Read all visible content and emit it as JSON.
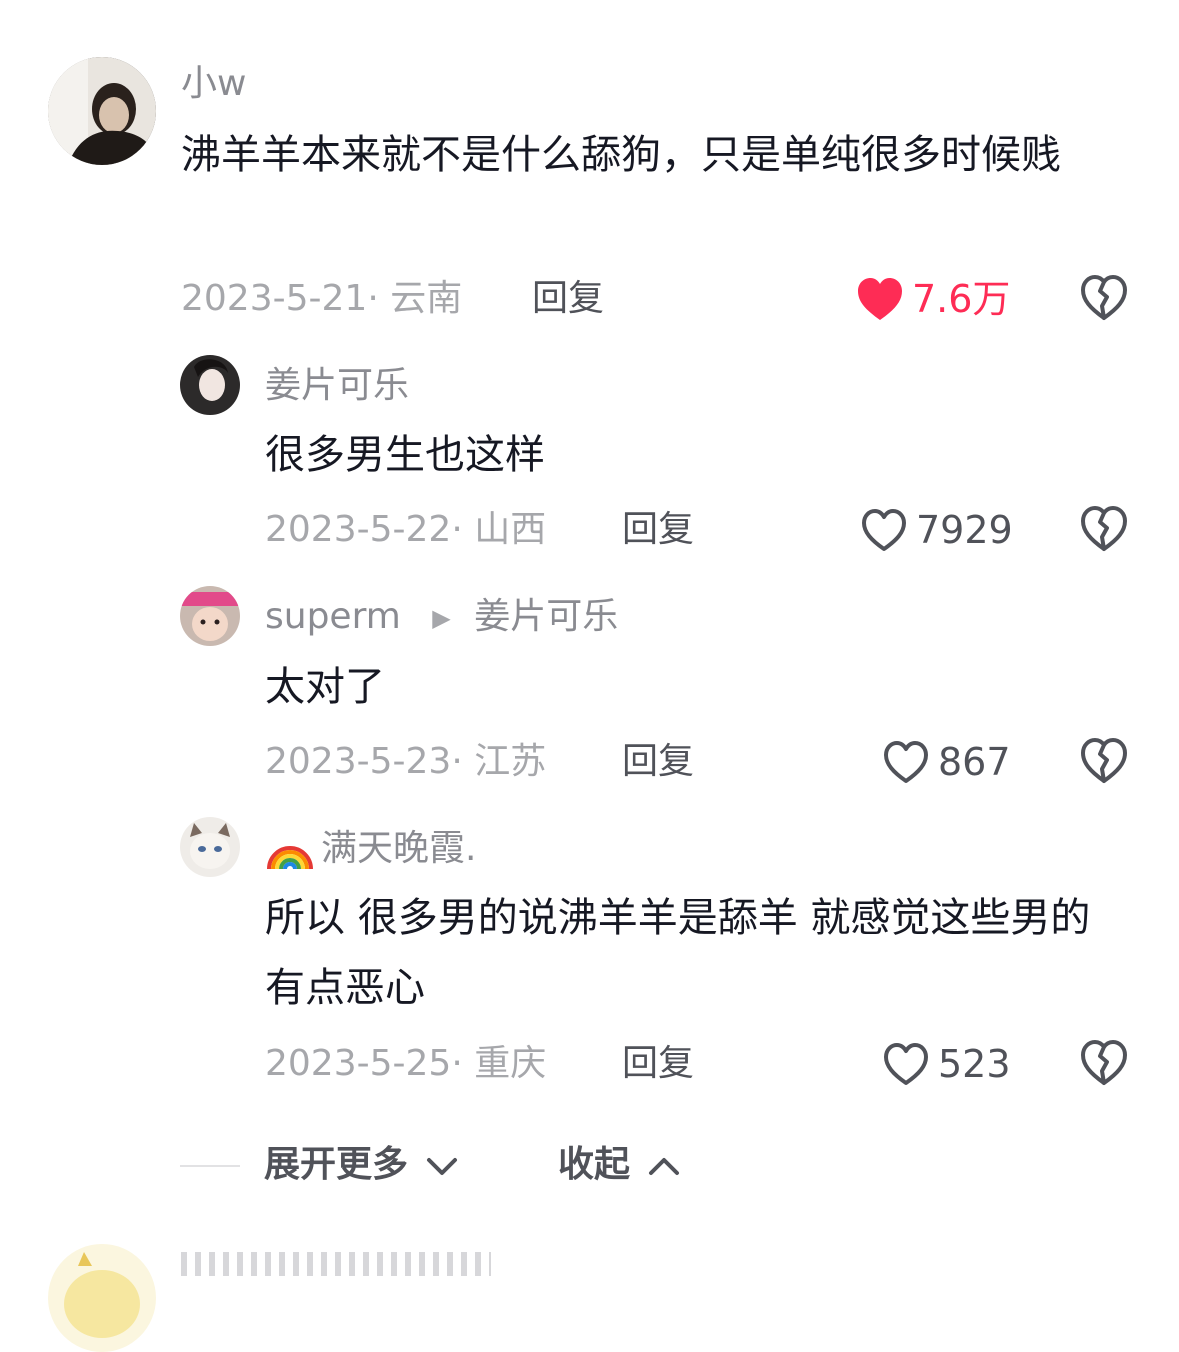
{
  "comments": [
    {
      "username": "小w",
      "text": "沸羊羊本来就不是什么舔狗，只是单纯很多时候贱",
      "date": "2023-5-21",
      "location": "云南",
      "reply_label": "回复",
      "likes": "7.6万",
      "liked": true
    },
    {
      "username": "姜片可乐",
      "text": "很多男生也这样",
      "date": "2023-5-22",
      "location": "山西",
      "reply_label": "回复",
      "likes": "7929",
      "liked": false
    },
    {
      "username": "superm",
      "reply_to": "姜片可乐",
      "text": "太对了",
      "date": "2023-5-23",
      "location": "江苏",
      "reply_label": "回复",
      "likes": "867",
      "liked": false
    },
    {
      "username_prefix_icon": "rainbow-emoji",
      "username": "满天晚霞.",
      "text": "所以 很多男的说沸羊羊是舔羊 就感觉这些男的有点恶心",
      "date": "2023-5-25",
      "location": "重庆",
      "reply_label": "回复",
      "likes": "523",
      "liked": false
    }
  ],
  "footer": {
    "expand_label": "展开更多",
    "collapse_label": "收起"
  },
  "colors": {
    "liked_heart": "#fe2c55",
    "meta_gray": "#a6a7ab",
    "name_gray": "#8a8b91"
  }
}
